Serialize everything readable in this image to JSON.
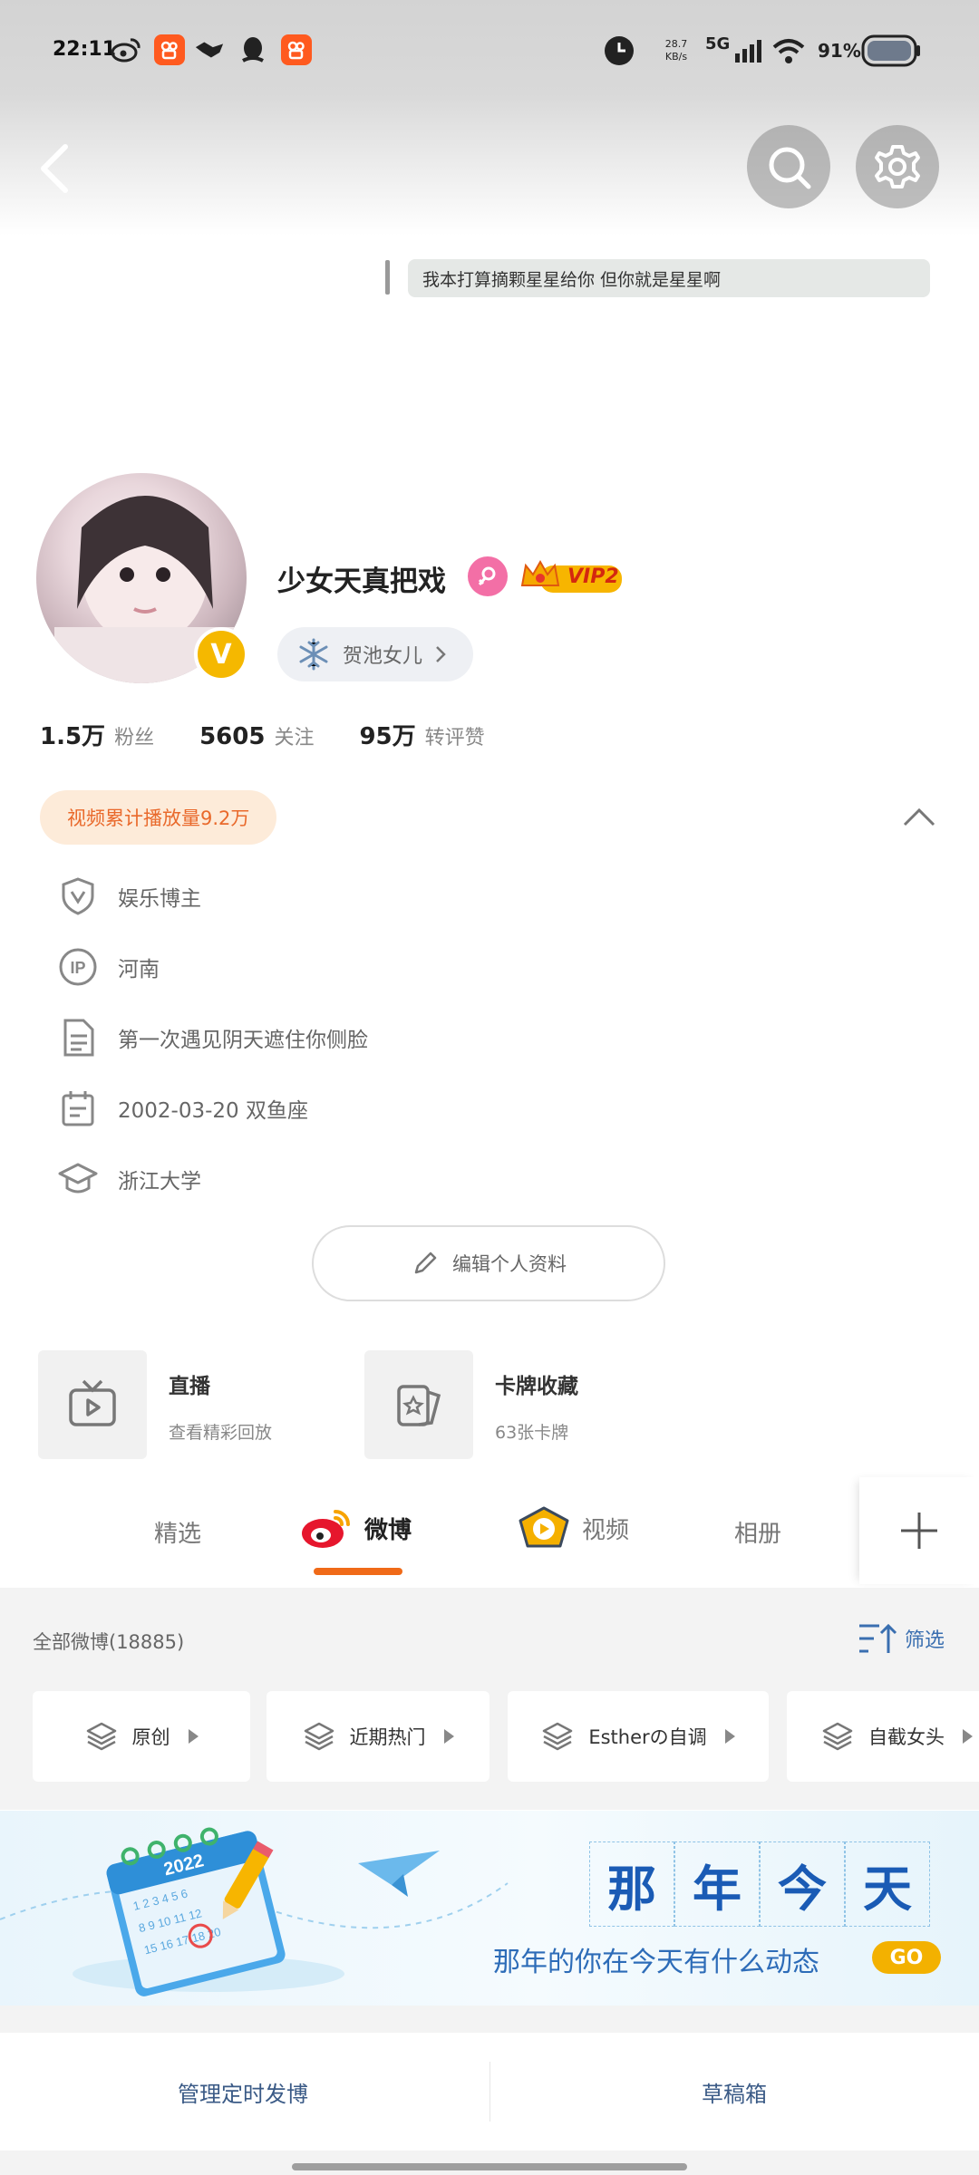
{
  "status_bar": {
    "time": "22:11",
    "net_speed_value": "28.7",
    "net_speed_unit": "KB/s",
    "network": "5G",
    "battery": "91%"
  },
  "header": {
    "signature": "我本打算摘颗星星给你  但你就是星星啊"
  },
  "profile": {
    "name": "少女天真把戏",
    "vip_label": "VIP2",
    "verify_badge": "V",
    "tag_label": "贺池女儿",
    "stats": [
      {
        "value": "1.5万",
        "label": "粉丝"
      },
      {
        "value": "5605",
        "label": "关注"
      },
      {
        "value": "95万",
        "label": "转评赞"
      }
    ],
    "video_plays": "视频累计播放量9.2万",
    "info": [
      {
        "icon": "verified-shield-icon",
        "text": "娱乐博主"
      },
      {
        "icon": "ip-location-icon",
        "text": "河南"
      },
      {
        "icon": "document-icon",
        "text": "第一次遇见阴天遮住你侧脸"
      },
      {
        "icon": "calendar-icon",
        "text": "2002-03-20 双鱼座"
      },
      {
        "icon": "graduation-cap-icon",
        "text": "浙江大学"
      }
    ],
    "edit_label": "编辑个人资料"
  },
  "cards": [
    {
      "title": "直播",
      "subtitle": "查看精彩回放",
      "icon": "live-tv-icon"
    },
    {
      "title": "卡牌收藏",
      "subtitle": "63张卡牌",
      "icon": "card-collection-icon"
    }
  ],
  "tabs": [
    {
      "label": "精选"
    },
    {
      "label": "微博",
      "active": true
    },
    {
      "label": "视频"
    },
    {
      "label": "相册"
    }
  ],
  "feed": {
    "all_count": "全部微博(18885)",
    "filter_label": "筛选",
    "chips": [
      "原创",
      "近期热门",
      "Estherの自调",
      "自截女头"
    ]
  },
  "banner": {
    "title_chars": [
      "那",
      "年",
      "今",
      "天"
    ],
    "subtitle": "那年的你在今天有什么动态",
    "go_label": "GO",
    "calendar_year": "2022"
  },
  "bottom_bar": {
    "left": "管理定时发博",
    "right": "草稿箱"
  },
  "colors": {
    "accent_orange": "#f06a18",
    "link_blue": "#3a6fb0",
    "vip_gold": "#f5b800"
  }
}
